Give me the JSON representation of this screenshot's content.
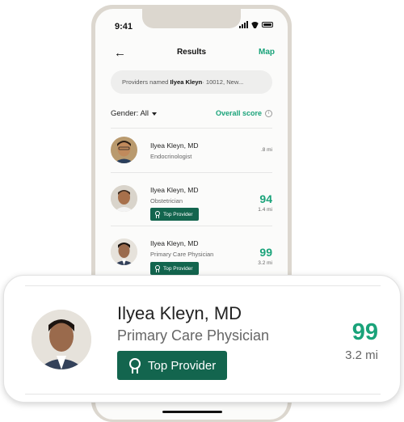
{
  "status_bar": {
    "time": "9:41"
  },
  "nav": {
    "back_icon": "←",
    "title": "Results",
    "map_label": "Map"
  },
  "search": {
    "prefix": "Providers named",
    "name": "Ilyea Kleyn",
    "suffix": " · 10012, New..."
  },
  "filters": {
    "gender_label": "Gender: All",
    "overall_score_label": "Overall score",
    "info_icon": "i"
  },
  "results": [
    {
      "name": "Ilyea Kleyn, MD",
      "specialty": "Endocrinologist",
      "score": "",
      "distance": ".8 mi",
      "badge": ""
    },
    {
      "name": "Ilyea Kleyn, MD",
      "specialty": "Obstetrician",
      "score": "94",
      "distance": "1.4 mi",
      "badge": "Top Provider"
    },
    {
      "name": "Ilyea Kleyn, MD",
      "specialty": "Primary Care Physician",
      "score": "99",
      "distance": "3.2 mi",
      "badge": "Top Provider"
    }
  ],
  "highlight": {
    "name": "Ilyea Kleyn, MD",
    "specialty": "Primary Care Physician",
    "score": "99",
    "distance": "3.2 mi",
    "badge": "Top Provider"
  },
  "colors": {
    "accent": "#1aa37a",
    "badge_bg": "#13654e",
    "phone_frame": "#dcd7cf"
  }
}
